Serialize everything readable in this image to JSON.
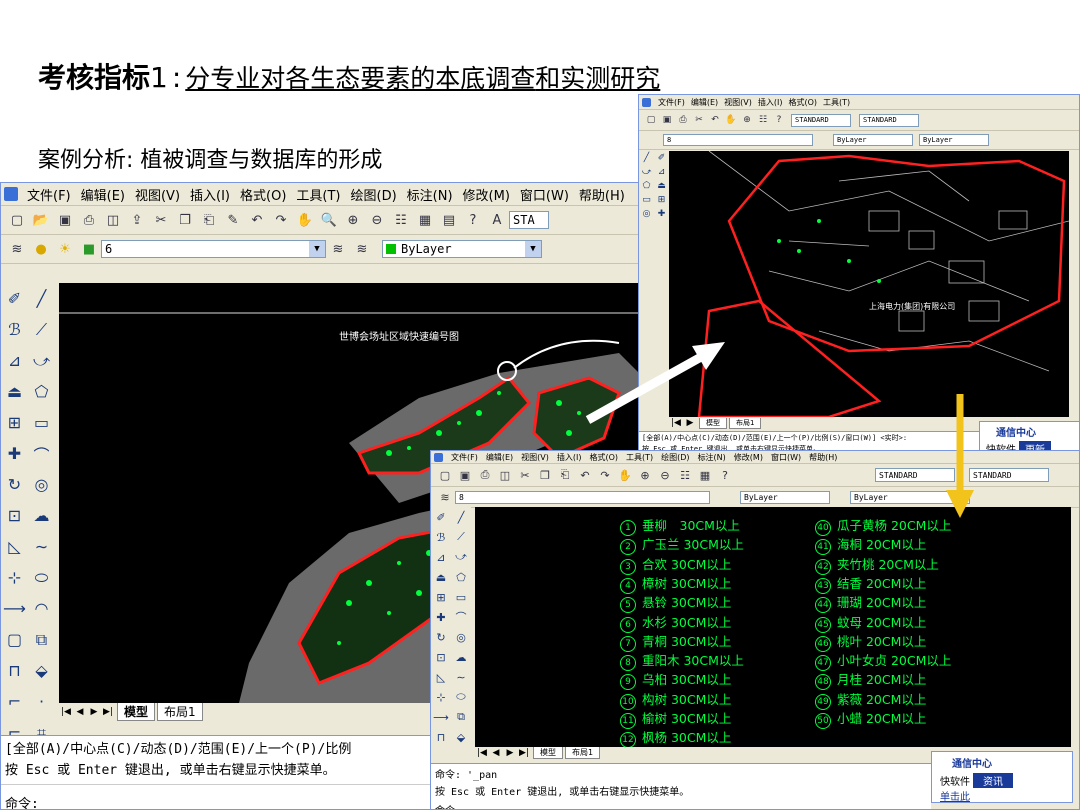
{
  "slide": {
    "title_bold": "考核指标",
    "title_num": "1",
    "title_sep": ":",
    "title_link1": "分专业对各生态要素的本底调查",
    "title_link2": "和实测研究",
    "subtitle": "案例分析: 植被调查与数据库的形成"
  },
  "main_window": {
    "menu": [
      "文件(F)",
      "编辑(E)",
      "视图(V)",
      "插入(I)",
      "格式(O)",
      "工具(T)",
      "绘图(D)",
      "标注(N)",
      "修改(M)",
      "窗口(W)",
      "帮助(H)"
    ],
    "layer_value": "6",
    "color_value": "ByLayer",
    "style_value": "STA",
    "map_label": "世博会场址区域快速编号图",
    "tab_model": "模型",
    "tab_layout": "布局1",
    "cmd_line1": "[全部(A)/中心点(C)/动态(D)/范围(E)/上一个(P)/比例",
    "cmd_line2": "按 Esc 或 Enter 键退出, 或单击右键显示快捷菜单。",
    "cmd_prompt": "命令:"
  },
  "top_window": {
    "style1": "STANDARD",
    "style2": "STANDARD",
    "color_value": "ByLayer",
    "ltype_value": "ByLayer",
    "layer_value": "8",
    "map_label": "上海电力(集团)有限公司",
    "tab_model": "模型",
    "tab_layout": "布局1",
    "cmd_line1": "[全部(A)/中心点(C)/动态(D)/范围(E)/上一个(P)/比例(S)/窗口(W)] <实时>:",
    "cmd_line2": "按 Esc 或 Enter 键退出, 或单击右键显示快捷菜单。",
    "comm_title": "通信中心",
    "comm_text": "更新",
    "comm_label": "快软件"
  },
  "bottom_window": {
    "menu": [
      "文件(F)",
      "编辑(E)",
      "视图(V)",
      "插入(I)",
      "格式(O)",
      "工具(T)",
      "绘图(D)",
      "标注(N)",
      "修改(M)",
      "窗口(W)",
      "帮助(H)"
    ],
    "style1": "STANDARD",
    "style2": "STANDARD",
    "color_value": "ByLayer",
    "ltype_value": "ByLayer",
    "layer_value": "8",
    "tab_model": "模型",
    "tab_layout": "布局1",
    "cmd_line1": "命令: '_pan",
    "cmd_line2": "按 Esc 或 Enter 键退出, 或单击右键显示快捷菜单。",
    "cmd_prompt": "命令:",
    "comm_title": "通信中心",
    "comm_text": "资讯",
    "comm_label": "快软件",
    "comm_link": "单击此",
    "legend_left": [
      {
        "n": "1",
        "t": "垂柳　30CM以上"
      },
      {
        "n": "2",
        "t": "广玉兰 30CM以上"
      },
      {
        "n": "3",
        "t": "合欢 30CM以上"
      },
      {
        "n": "4",
        "t": "樟树 30CM以上"
      },
      {
        "n": "5",
        "t": "悬铃 30CM以上"
      },
      {
        "n": "6",
        "t": "水杉 30CM以上"
      },
      {
        "n": "7",
        "t": "青桐 30CM以上"
      },
      {
        "n": "8",
        "t": "重阳木 30CM以上"
      },
      {
        "n": "9",
        "t": "乌桕 30CM以上"
      },
      {
        "n": "10",
        "t": "构树 30CM以上"
      },
      {
        "n": "11",
        "t": "榆树 30CM以上"
      },
      {
        "n": "12",
        "t": "枫杨 30CM以上"
      }
    ],
    "legend_right": [
      {
        "n": "40",
        "t": "瓜子黄杨 20CM以上"
      },
      {
        "n": "41",
        "t": "海桐 20CM以上"
      },
      {
        "n": "42",
        "t": "夹竹桃 20CM以上"
      },
      {
        "n": "43",
        "t": "结香 20CM以上"
      },
      {
        "n": "44",
        "t": "珊瑚 20CM以上"
      },
      {
        "n": "45",
        "t": "蚊母 20CM以上"
      },
      {
        "n": "46",
        "t": "桃叶 20CM以上"
      },
      {
        "n": "47",
        "t": "小叶女贞 20CM以上"
      },
      {
        "n": "48",
        "t": "月桂 20CM以上"
      },
      {
        "n": "49",
        "t": "紫薇 20CM以上"
      },
      {
        "n": "50",
        "t": "小蜡 20CM以上"
      }
    ]
  },
  "colors": {
    "canvas": "#000000",
    "boundary": "#ff2020",
    "vegetation": "#00ff3c",
    "arrow_yellow": "#f2c41b"
  }
}
